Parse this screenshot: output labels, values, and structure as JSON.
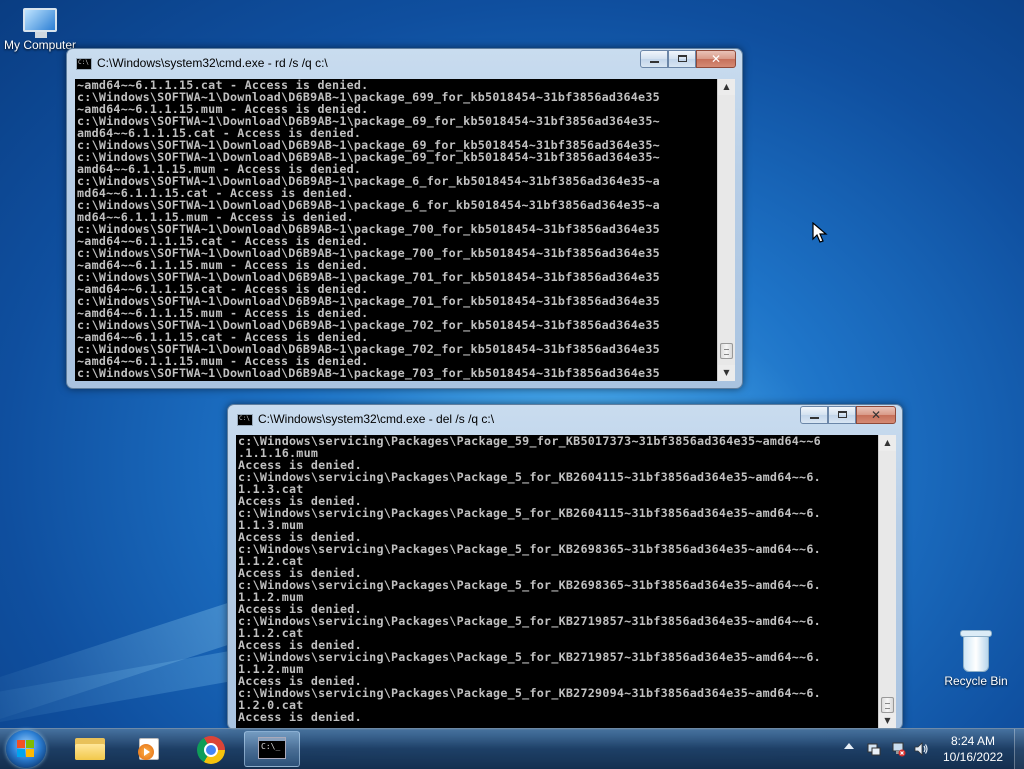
{
  "desktop": {
    "icons": [
      {
        "label": "My Computer",
        "icon": "monitor-icon"
      },
      {
        "label": "Recycle Bin",
        "icon": "recycle-bin-icon"
      }
    ]
  },
  "window1": {
    "title": "C:\\Windows\\system32\\cmd.exe - rd  /s /q c:\\",
    "console_text": "~amd64~~6.1.1.15.cat - Access is denied.\nc:\\Windows\\SOFTWA~1\\Download\\D6B9AB~1\\package_699_for_kb5018454~31bf3856ad364e35\n~amd64~~6.1.1.15.mum - Access is denied.\nc:\\Windows\\SOFTWA~1\\Download\\D6B9AB~1\\package_69_for_kb5018454~31bf3856ad364e35~\namd64~~6.1.1.15.cat - Access is denied.\nc:\\Windows\\SOFTWA~1\\Download\\D6B9AB~1\\package_69_for_kb5018454~31bf3856ad364e35~\nc:\\Windows\\SOFTWA~1\\Download\\D6B9AB~1\\package_69_for_kb5018454~31bf3856ad364e35~\namd64~~6.1.1.15.mum - Access is denied.\nc:\\Windows\\SOFTWA~1\\Download\\D6B9AB~1\\package_6_for_kb5018454~31bf3856ad364e35~a\nmd64~~6.1.1.15.cat - Access is denied.\nc:\\Windows\\SOFTWA~1\\Download\\D6B9AB~1\\package_6_for_kb5018454~31bf3856ad364e35~a\nmd64~~6.1.1.15.mum - Access is denied.\nc:\\Windows\\SOFTWA~1\\Download\\D6B9AB~1\\package_700_for_kb5018454~31bf3856ad364e35\n~amd64~~6.1.1.15.cat - Access is denied.\nc:\\Windows\\SOFTWA~1\\Download\\D6B9AB~1\\package_700_for_kb5018454~31bf3856ad364e35\n~amd64~~6.1.1.15.mum - Access is denied.\nc:\\Windows\\SOFTWA~1\\Download\\D6B9AB~1\\package_701_for_kb5018454~31bf3856ad364e35\n~amd64~~6.1.1.15.cat - Access is denied.\nc:\\Windows\\SOFTWA~1\\Download\\D6B9AB~1\\package_701_for_kb5018454~31bf3856ad364e35\n~amd64~~6.1.1.15.mum - Access is denied.\nc:\\Windows\\SOFTWA~1\\Download\\D6B9AB~1\\package_702_for_kb5018454~31bf3856ad364e35\n~amd64~~6.1.1.15.cat - Access is denied.\nc:\\Windows\\SOFTWA~1\\Download\\D6B9AB~1\\package_702_for_kb5018454~31bf3856ad364e35\n~amd64~~6.1.1.15.mum - Access is denied.\nc:\\Windows\\SOFTWA~1\\Download\\D6B9AB~1\\package_703_for_kb5018454~31bf3856ad364e35"
  },
  "window2": {
    "title": "C:\\Windows\\system32\\cmd.exe - del  /s /q c:\\",
    "console_text": "c:\\Windows\\servicing\\Packages\\Package_59_for_KB5017373~31bf3856ad364e35~amd64~~6\n.1.1.16.mum\nAccess is denied.\nc:\\Windows\\servicing\\Packages\\Package_5_for_KB2604115~31bf3856ad364e35~amd64~~6.\n1.1.3.cat\nAccess is denied.\nc:\\Windows\\servicing\\Packages\\Package_5_for_KB2604115~31bf3856ad364e35~amd64~~6.\n1.1.3.mum\nAccess is denied.\nc:\\Windows\\servicing\\Packages\\Package_5_for_KB2698365~31bf3856ad364e35~amd64~~6.\n1.1.2.cat\nAccess is denied.\nc:\\Windows\\servicing\\Packages\\Package_5_for_KB2698365~31bf3856ad364e35~amd64~~6.\n1.1.2.mum\nAccess is denied.\nc:\\Windows\\servicing\\Packages\\Package_5_for_KB2719857~31bf3856ad364e35~amd64~~6.\n1.1.2.cat\nAccess is denied.\nc:\\Windows\\servicing\\Packages\\Package_5_for_KB2719857~31bf3856ad364e35~amd64~~6.\n1.1.2.mum\nAccess is denied.\nc:\\Windows\\servicing\\Packages\\Package_5_for_KB2729094~31bf3856ad364e35~amd64~~6.\n1.2.0.cat\nAccess is denied."
  },
  "taskbar": {
    "pinned": [
      {
        "name": "windows-explorer",
        "icon": "folder-icon"
      },
      {
        "name": "media-player",
        "icon": "media-player-icon"
      },
      {
        "name": "chrome",
        "icon": "chrome-icon"
      },
      {
        "name": "command-prompt",
        "icon": "cmd-icon",
        "active": true
      }
    ],
    "clock_time": "8:24 AM",
    "clock_date": "10/16/2022"
  },
  "colors": {
    "console_bg": "#000000",
    "console_fg": "#c0c0c0",
    "desktop_blue": "#1e74c8"
  }
}
